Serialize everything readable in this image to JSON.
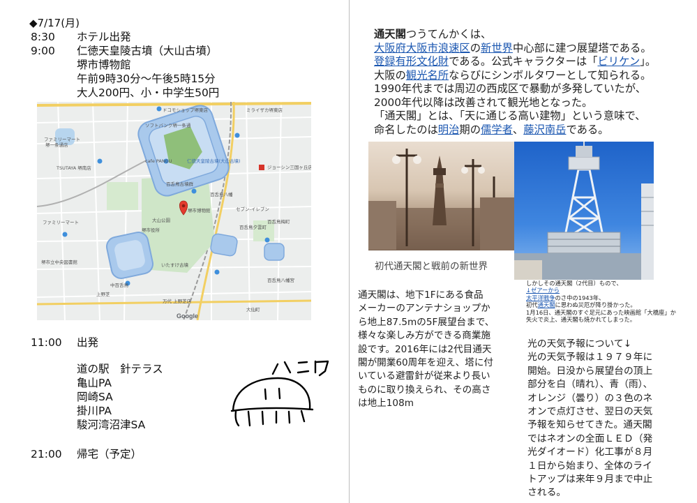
{
  "left": {
    "date": "◆7/17(月)",
    "schedule": [
      {
        "time": "8:30",
        "text": "ホテル出発"
      },
      {
        "time": "9:00",
        "text": "仁徳天皇陵古墳（大山古墳）"
      }
    ],
    "museum": {
      "name": "堺市博物館",
      "hours": "午前9時30分～午後5時15分",
      "fee": "大人200円、小・中学生50円"
    },
    "depart": {
      "time": "11:00",
      "text": "出発"
    },
    "stops": [
      "道の駅　針テラス",
      "亀山PA",
      "岡崎SA",
      "掛川PA",
      "駿河湾沼津SA"
    ],
    "return": {
      "time": "21:00",
      "text": "帰宅（予定）"
    },
    "doodle_text": "ハニワ",
    "map": {
      "labels": [
        "ソフトバンク堺一条通",
        "ドコモショップ堺東店",
        "ミライザカ堺東店",
        "ファミリーマート",
        "堺一条通店",
        "TSUTAYA 堺南店",
        "cafe PANGU",
        "仁徳天皇陵古墳(大山古墳)",
        "ジョーシン三国ヶ丘店",
        "百舌鳥古墳群",
        "百舌鳥八幡",
        "堺市博物館",
        "セブン-イレブン",
        "大山公園",
        "堺市役所",
        "百舌鳥夕雲町",
        "いたすけ古墳",
        "万代 上野芝店",
        "中百舌鳥",
        "上野芝",
        "百舌鳥梅町",
        "ファミリーマート",
        "百舌鳥八幡宮",
        "大仙町",
        "堺市立中央図書館",
        "Google"
      ]
    }
  },
  "right": {
    "tsutenkaku_title": "通天閣",
    "p1": [
      [
        {
          "t": "通天閣",
          "b": true
        },
        {
          "t": "つうてんかくは、"
        }
      ],
      [
        {
          "t": "大阪府",
          "l": true
        },
        {
          "t": "大阪市",
          "l": true
        },
        {
          "t": "浪速区",
          "l": true
        },
        {
          "t": "の"
        },
        {
          "t": "新世界",
          "l": true
        },
        {
          "t": "中心部に建つ展望塔である。"
        }
      ],
      [
        {
          "t": "登録有形文化財",
          "l": true
        },
        {
          "t": "である。公式キャラクターは「"
        },
        {
          "t": "ビリケン",
          "l": true
        },
        {
          "t": "」。"
        }
      ],
      [
        {
          "t": "大阪の"
        },
        {
          "t": "観光名所",
          "l": true
        },
        {
          "t": "ならびにシンボルタワーとして知られる。"
        }
      ],
      [
        {
          "t": "1990年代までは周辺の西成区で暴動が多発していたが、"
        }
      ],
      [
        {
          "t": "2000年代以降は改善されて観光地となった。"
        }
      ],
      [
        {
          "t": "「通天閣」とは、「天に通じる高い建物」という意味で、"
        }
      ],
      [
        {
          "t": "命名したのは"
        },
        {
          "t": "明治",
          "l": true
        },
        {
          "t": "期の"
        },
        {
          "t": "儒学者",
          "l": true
        },
        {
          "t": "、"
        },
        {
          "t": "藤沢南岳",
          "l": true
        },
        {
          "t": "である。"
        }
      ]
    ],
    "photo_caption": "初代通天閣と戦前の新世界",
    "small_caption": [
      [
        {
          "t": "しかしその通天閣（2代目）もので、"
        }
      ],
      [
        {
          "t": "↓ゼアーから",
          "l": true
        }
      ],
      [
        {
          "t": "太平洋戦争",
          "l": true
        },
        {
          "t": "のさ中の1943年、"
        }
      ],
      [
        {
          "t": "初代"
        },
        {
          "t": "通天閣",
          "l": true
        },
        {
          "t": "に思わぬ災厄が降り掛かった。"
        }
      ],
      [
        {
          "t": "1月16日、通天閣のすぐ足元にあった映画館「大橋座」か"
        }
      ],
      [
        {
          "t": "失火で炎上、通天閣も焼かれてしまった。"
        }
      ]
    ],
    "p2": [
      "通天閣は、地下1Fにある食品",
      "メーカーのアンテナショップか",
      "ら地上87.5mの5F展望台まで、",
      "様々な楽しみ方ができる商業施",
      "設です。2016年には2代目通天",
      "閣が開業60周年を迎え、塔に付",
      "いている避雷針が従来より長い",
      "ものに取り換えられ、その高さ",
      "は地上108m"
    ],
    "p3": [
      "光の天気予報について↓",
      "光の天気予報は１９７９年に",
      "開始。日没から展望台の頂上",
      "部分を白（晴れ）、青（雨）、",
      "オレンジ（曇り）の３色のネ",
      "オンで点灯させ、翌日の天気",
      "予報を知らせてきた。通天閣",
      "ではネオンの全面ＬＥＤ（発",
      "光ダイオード）化工事が８月",
      "１日から始まり、全体のライ",
      "トアップは来年９月まで中止",
      "される。"
    ]
  }
}
